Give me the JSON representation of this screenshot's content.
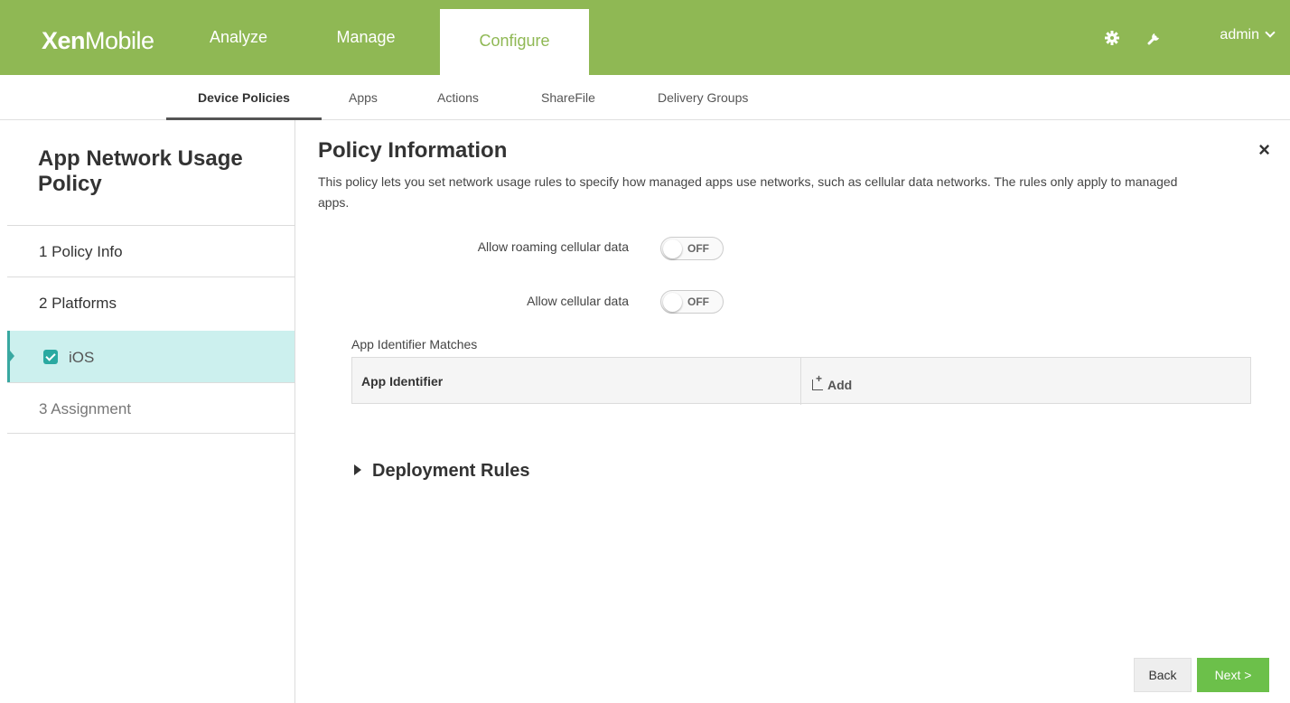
{
  "topbar": {
    "brand_bold": "Xen",
    "brand_light": "Mobile",
    "tabs": [
      {
        "label": "Analyze"
      },
      {
        "label": "Manage"
      },
      {
        "label": "Configure"
      }
    ],
    "settings_icon": "gear-icon",
    "tools_icon": "wrench-icon",
    "user_label": "admin"
  },
  "subnav": {
    "items": [
      {
        "label": "Device Policies"
      },
      {
        "label": "Apps"
      },
      {
        "label": "Actions"
      },
      {
        "label": "ShareFile"
      },
      {
        "label": "Delivery Groups"
      }
    ]
  },
  "sidebar": {
    "title": "App Network Usage Policy",
    "items": [
      {
        "label": "1  Policy Info"
      },
      {
        "label": "2  Platforms"
      },
      {
        "label": "iOS"
      },
      {
        "label": "3  Assignment"
      }
    ]
  },
  "main": {
    "title": "Policy Information",
    "close": "×",
    "description": "This policy lets you set network usage rules to specify how managed apps use networks, such as cellular data networks. The rules only apply to managed apps.",
    "fields": [
      {
        "label": "Allow roaming cellular data",
        "value": "OFF"
      },
      {
        "label": "Allow cellular data",
        "value": "OFF"
      }
    ],
    "matches_label": "App Identifier Matches",
    "table": {
      "header": "App Identifier",
      "add_label": "Add"
    },
    "deployment_rules": "Deployment Rules",
    "back_label": "Back",
    "next_label": "Next >"
  },
  "colors": {
    "topbar": "#8fb854",
    "accent_teal": "#2aa9a1",
    "selected_bg": "#ccf0ee",
    "next_button": "#6cc04a"
  }
}
